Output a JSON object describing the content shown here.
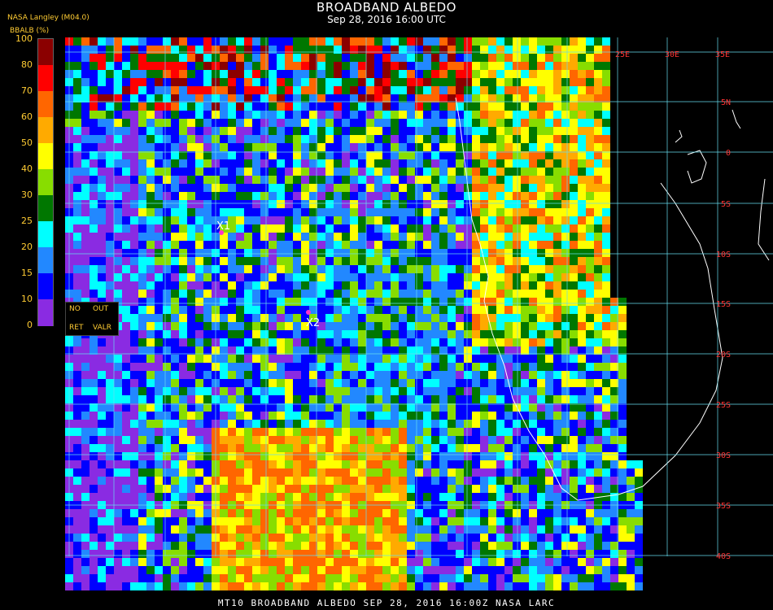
{
  "header": {
    "title": "BROADBAND ALBEDO",
    "datetime": "Sep 28, 2016 16:00 UTC",
    "source": "NASA Langley (M04.0)",
    "variable": "BBALB (%)"
  },
  "colorbar": {
    "ticks": [
      "100",
      "80",
      "70",
      "60",
      "50",
      "40",
      "30",
      "25",
      "20",
      "15",
      "10",
      "0"
    ],
    "colors": [
      "#8b0000",
      "#ff0000",
      "#ff6600",
      "#ffaa00",
      "#ffff00",
      "#88dd00",
      "#007700",
      "#00ffff",
      "#2288ff",
      "#0000ff",
      "#8a2be2"
    ]
  },
  "legend": {
    "no": "NO",
    "out": "OUT",
    "ret": "RET",
    "valr": "VALR"
  },
  "markers": [
    {
      "label": "X1"
    },
    {
      "label": "X2"
    }
  ],
  "grid": {
    "lon_labels": [
      "25E",
      "30E",
      "35E"
    ],
    "lat_labels": [
      "5N",
      "0",
      "5S",
      "10S",
      "15S",
      "20S",
      "25S",
      "30S",
      "35S",
      "40S"
    ],
    "line_color": "#66ddee",
    "label_color": "#ff3333"
  },
  "footer": {
    "text": "MT10  BROADBAND ALBEDO  SEP 28, 2016 16:00Z  NASA LARC"
  }
}
